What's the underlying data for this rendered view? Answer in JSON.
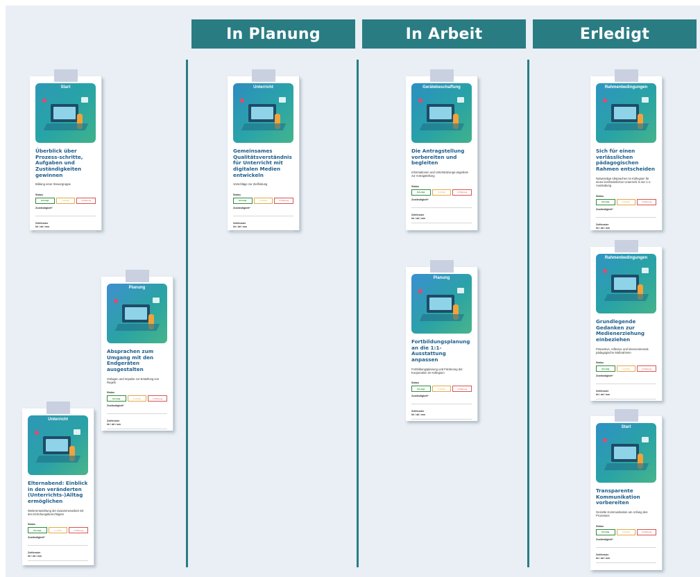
{
  "columns": [
    {
      "title": "In Planung"
    },
    {
      "title": "In Arbeit"
    },
    {
      "title": "Erledigt"
    }
  ],
  "status": {
    "label": "Status",
    "done": "Erledigt",
    "work": "In Arbeit",
    "plan": "In Planung",
    "responsible": "Zuständigkeit*",
    "period": "Zeitfenster",
    "time": "hh / dd / mm"
  },
  "cards": [
    {
      "category": "Start",
      "title": "Überblick über Prozess-schritte, Aufgaben und Zuständigkeiten gewinnen",
      "subtitle": "Bildung einer Steuergruppe"
    },
    {
      "category": "Planung",
      "title": "Absprachen zum Umgang mit den Endgeräten ausgestalten",
      "subtitle": "Vorlagen und Impulse zur Erstellung von Regeln"
    },
    {
      "category": "Unterricht",
      "title": "Elternabend: Einblick in den veränderten (Unterrichts-)Alltag ermöglichen",
      "subtitle": "Weiterentwicklung der Zusammenarbeit mit den Erziehungsberechtigten"
    },
    {
      "category": "Unterricht",
      "title": "Gemeinsames Qualitätsverständnis für Unterricht mit digitalen Medien entwickeln",
      "subtitle": "Vorschläge zur Zielfindung"
    },
    {
      "category": "Gerätebeschaffung",
      "title": "Die Antragstellung vorbereiten und begleiten",
      "subtitle": "Informationen und Unterstützungs-angebote zur Antragstellung"
    },
    {
      "category": "Planung",
      "title": "Fortbildungsplanung an die 1:1-Ausstattung anpassen",
      "subtitle": "Fortbildungsplanung und Förderung der Kooperation im Kollegium"
    },
    {
      "category": "Rahmenbedingungen",
      "title": "Sich für einen verlässlichen pädagogischen Rahmen entscheiden",
      "subtitle": "Notwendige Absprachen im Kollegium für einen lernförderlichen Unterricht in der 1:1-Ausstattung"
    },
    {
      "category": "Rahmenbedingungen",
      "title": "Grundlegende Gedanken zur Medienerziehung einbeziehen",
      "subtitle": "Präventive, reflexive und intervenierende pädagogische Maßnahmen"
    },
    {
      "category": "Start",
      "title": "Transparente Kommunikation vorbereiten",
      "subtitle": "Gezielte Kommunikation am Anfang des Prozesses"
    }
  ]
}
